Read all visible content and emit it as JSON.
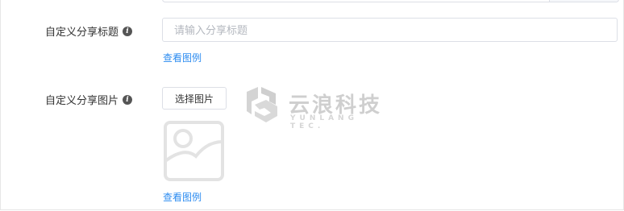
{
  "form": {
    "share_title": {
      "label": "自定义分享标题",
      "placeholder": "请输入分享标题",
      "value": "",
      "example_link": "查看图例"
    },
    "share_image": {
      "label": "自定义分享图片",
      "choose_button": "选择图片",
      "example_link": "查看图例"
    }
  },
  "watermark": {
    "title": "云浪科技",
    "subtitle": "YUNLANG TEC."
  },
  "colors": {
    "link": "#2d8cf0",
    "label": "#333333",
    "border": "#dcdfe6",
    "placeholder_icon": "#e3e3e3"
  },
  "icons": {
    "info": "info-circle-icon",
    "image_placeholder": "image-placeholder-icon",
    "watermark_logo": "yunlang-logo-icon"
  }
}
